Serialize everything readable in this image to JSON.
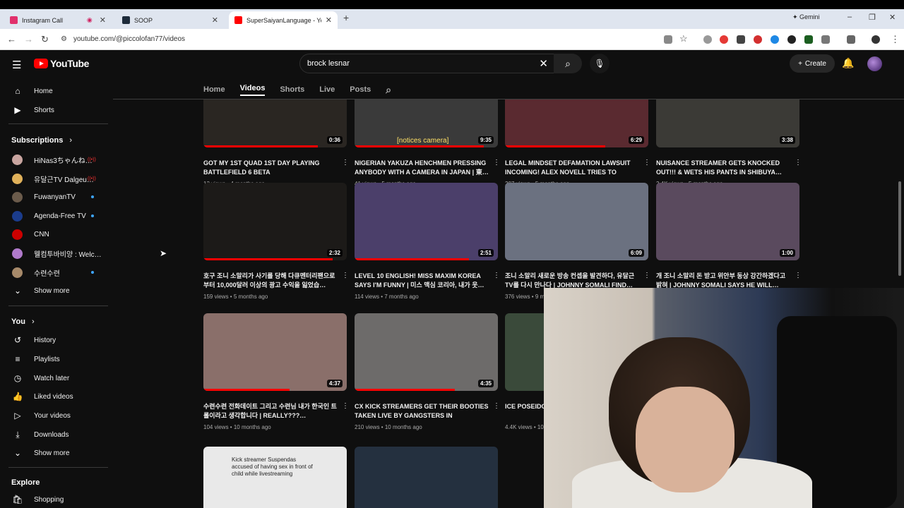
{
  "browser": {
    "tabs": [
      {
        "title": "Instagram Call",
        "favicon_color": "#e1306c"
      },
      {
        "title": "SOOP",
        "favicon_color": "#1d2b3a"
      },
      {
        "title": "SuperSaiyanLanguage - YouTu…",
        "favicon_color": "#ff0000"
      }
    ],
    "gemini_label": "Gemini",
    "url": "youtube.com/@piccolofan77/videos"
  },
  "youtube": {
    "logo_text": "YouTube",
    "search_value": "brock lesnar",
    "create_label": "Create",
    "tabs": [
      "Home",
      "Videos",
      "Shorts",
      "Live",
      "Posts"
    ],
    "active_tab": "Videos"
  },
  "sidebar": {
    "top": [
      {
        "label": "Home",
        "icon": "home-icon"
      },
      {
        "label": "Shorts",
        "icon": "shorts-icon"
      }
    ],
    "subscriptions_header": "Subscriptions",
    "subscriptions": [
      {
        "label": "HiNas3ちゃんね…",
        "indicator": "live",
        "color": "#c9a5a0"
      },
      {
        "label": "유달근TV Dalgeu…",
        "indicator": "live",
        "color": "#e0b15a"
      },
      {
        "label": "FuwanyanTV",
        "indicator": "dot",
        "color": "#6b5b4b"
      },
      {
        "label": "Agenda-Free TV",
        "indicator": "dot",
        "color": "#1b3c8c"
      },
      {
        "label": "CNN",
        "indicator": "none",
        "color": "#cc0000"
      },
      {
        "label": "웰컴투바비양 : Welc…",
        "indicator": "none",
        "color": "#b07acb"
      },
      {
        "label": "수련수련",
        "indicator": "dot",
        "color": "#a78a6a"
      }
    ],
    "show_more": "Show more",
    "you_header": "You",
    "you_items": [
      {
        "label": "History",
        "icon": "history-icon"
      },
      {
        "label": "Playlists",
        "icon": "playlists-icon"
      },
      {
        "label": "Watch later",
        "icon": "watch-later-icon"
      },
      {
        "label": "Liked videos",
        "icon": "liked-icon"
      },
      {
        "label": "Your videos",
        "icon": "your-videos-icon"
      },
      {
        "label": "Downloads",
        "icon": "downloads-icon"
      }
    ],
    "show_more_2": "Show more",
    "explore_header": "Explore",
    "explore_items": [
      {
        "label": "Shopping"
      }
    ]
  },
  "videos": [
    {
      "title": "GOT MY 1ST QUAD 1ST DAY PLAYING BATTLEFIELD 6 BETA",
      "views": "13 views",
      "age": "4 months ago",
      "duration": "0:36",
      "thumb": "#2a2622",
      "progress": 0.8
    },
    {
      "title": "NIGERIAN YAKUZA HENCHMEN PRESSING ANYBODY WITH A CAMERA IN JAPAN | 東…",
      "views": "41 views",
      "age": "5 months ago",
      "duration": "9:35",
      "thumb": "#3a3a3a",
      "caption": "[notices camera]",
      "progress": 0.9
    },
    {
      "title": "LEGAL MINDSET DEFAMATION LAWSUIT INCOMING! ALEX NOVELL TRIES TO PLAY…",
      "views": "207 views",
      "age": "5 months ago",
      "duration": "6:29",
      "thumb": "#5a2a30",
      "progress": 0.7
    },
    {
      "title": "NUISANCE STREAMER GETS KNOCKED OUT!!! & WETS HIS PANTS IN SHIBUYA…",
      "views": "2.4K views",
      "age": "5 months ago",
      "duration": "3:38",
      "thumb": "#3b3a36",
      "progress": 0
    },
    {
      "title": "호구 조니 소말리가 사기를 당해 다큐멘터리팬으로부터 10,000달러 이상의 광고 수익을 잃었습…",
      "views": "159 views",
      "age": "5 months ago",
      "duration": "2:32",
      "thumb": "#1c1a18",
      "progress": 0.9
    },
    {
      "title": "LEVEL 10 ENGLISH! MISS MAXIM KOREA SAYS I'M FUNNY | 미스 맥심 코리아, 내가 웃…",
      "views": "114 views",
      "age": "7 months ago",
      "duration": "2:51",
      "thumb": "#4b3f6a",
      "progress": 0.8
    },
    {
      "title": "조니 소말리 새로운 방송 컨셉을 발견하다, 유달근TV를 다시 만나다 | JOHNNY SOMALI FIND…",
      "views": "376 views",
      "age": "9 m…",
      "duration": "6:09",
      "thumb": "#6b7180",
      "progress": 0
    },
    {
      "title": "개 조니 소말리 돈 받고 위안부 동상 강간하겠다고 밝혀 | JOHNNY SOMALI SAYS HE WILL…",
      "views": "",
      "age": "",
      "duration": "1:00",
      "thumb": "#5a4a5e",
      "progress": 0
    },
    {
      "title": "수련수련 전화데이트 그리고 수련님 내가 한국인 트롤이라고 생각합니다 | REALLY???…",
      "views": "104 views",
      "age": "10 months ago",
      "duration": "4:37",
      "thumb": "#8a6f6a",
      "progress": 0.6
    },
    {
      "title": "CX KICK STREAMERS GET THEIR BOOTIES TAKEN LIVE BY GANGSTERS IN SAPPORO…",
      "views": "210 views",
      "age": "10 months ago",
      "duration": "4:35",
      "thumb": "#6d6b6a",
      "progress": 0.7
    },
    {
      "title": "ICE POSEIDO… ANGRY JAPA…",
      "views": "4.4K views",
      "age": "10…",
      "duration": "",
      "thumb": "#3a4a3a",
      "progress": 0
    },
    {
      "title": "",
      "views": "",
      "age": "",
      "duration": "",
      "thumb": "#403d3a",
      "progress": 0
    },
    {
      "title": "",
      "views": "",
      "age": "",
      "duration": "",
      "thumb": "#e9e9e9",
      "caption2": "Kick streamer Suspendas accused of having sex in front of child while livestreaming",
      "progress": 0
    },
    {
      "title": "",
      "views": "",
      "age": "",
      "duration": "",
      "thumb": "#24303f",
      "progress": 0
    }
  ]
}
